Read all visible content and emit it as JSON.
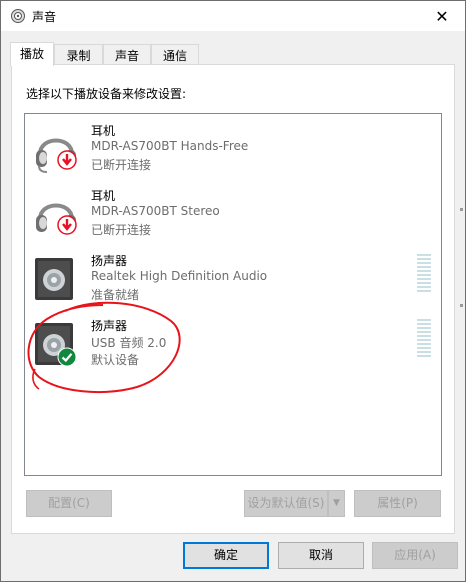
{
  "window": {
    "title": "声音",
    "close_glyph": "✕"
  },
  "tabs": [
    {
      "label": "播放",
      "active": true
    },
    {
      "label": "录制",
      "active": false
    },
    {
      "label": "声音",
      "active": false
    },
    {
      "label": "通信",
      "active": false
    }
  ],
  "instruction": "选择以下播放设备来修改设置:",
  "devices": [
    {
      "name": "耳机",
      "model": "MDR-AS700BT Hands-Free",
      "status": "已断开连接",
      "icon": "headset-icon",
      "badge": "disconnected-arrow-icon"
    },
    {
      "name": "耳机",
      "model": "MDR-AS700BT Stereo",
      "status": "已断开连接",
      "icon": "headset-icon",
      "badge": "disconnected-arrow-icon"
    },
    {
      "name": "扬声器",
      "model": "Realtek High Definition Audio",
      "status": "准备就绪",
      "icon": "speaker-icon",
      "badge": ""
    },
    {
      "name": "扬声器",
      "model": "USB 音频 2.0",
      "status": "默认设备",
      "icon": "speaker-icon",
      "badge": "default-check-icon"
    }
  ],
  "buttons": {
    "configure": "配置(C)",
    "set_default": "设为默认值(S)",
    "properties": "属性(P)",
    "ok": "确定",
    "cancel": "取消",
    "apply": "应用(A)"
  },
  "colors": {
    "accent": "#0078d7",
    "check_green": "#10893e",
    "disconnect_red": "#e81123",
    "annotation_red": "#e8141a"
  }
}
